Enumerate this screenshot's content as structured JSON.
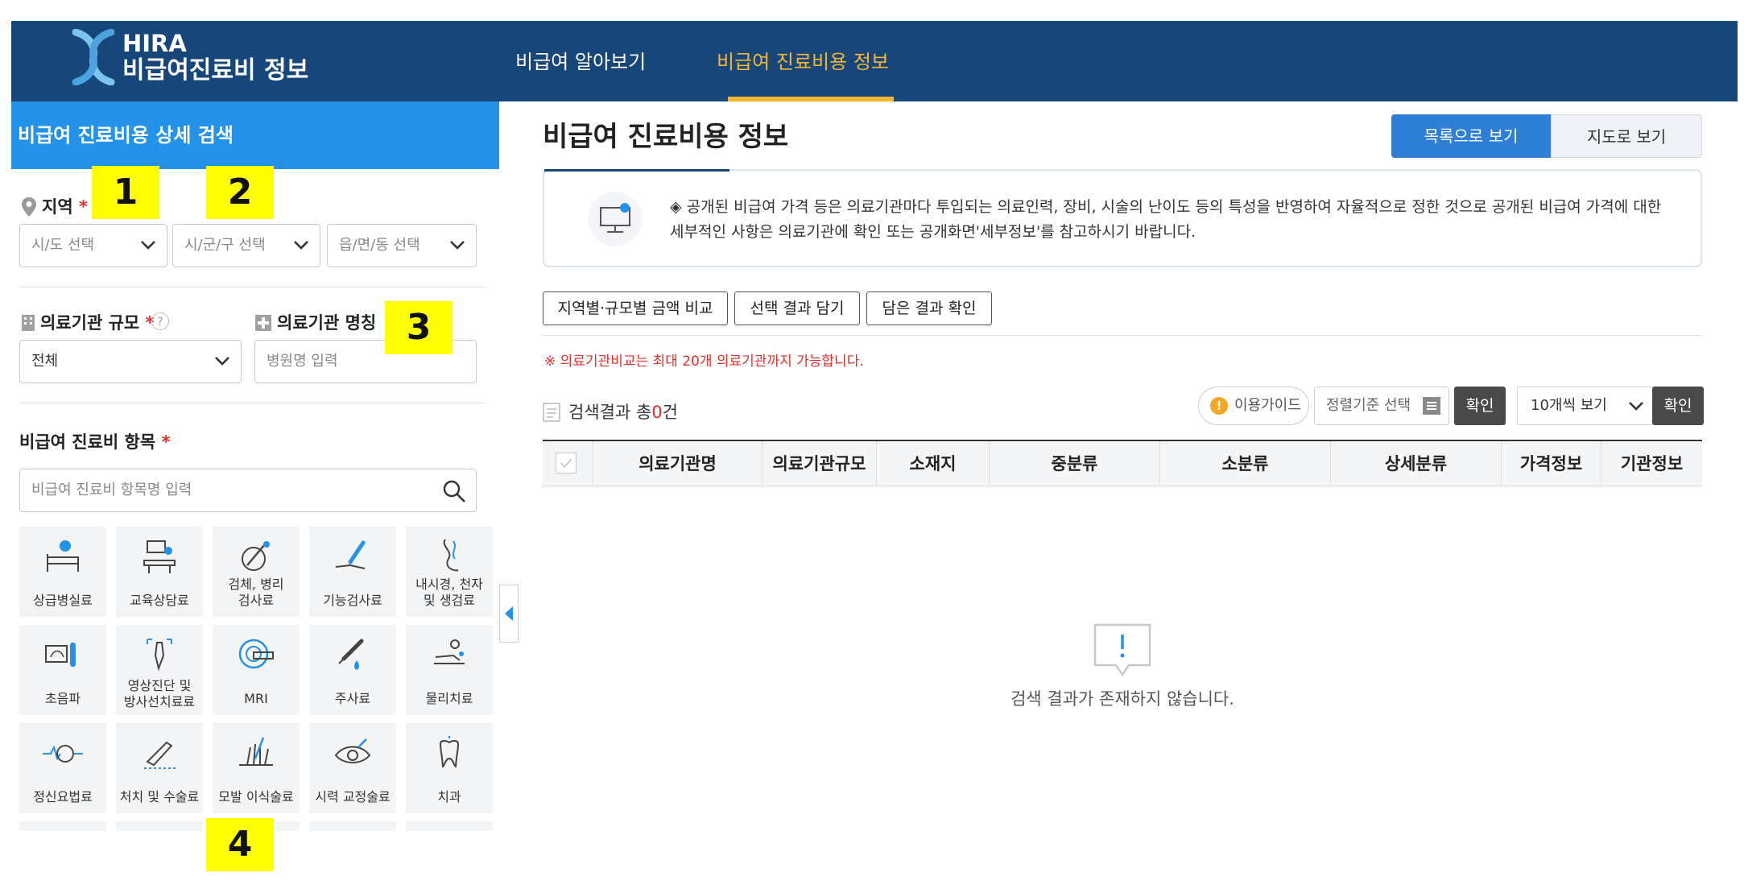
{
  "header": {
    "logo_en": "HIRA",
    "logo_kr": "비급여진료비 정보",
    "nav": [
      {
        "label": "비급여 알아보기",
        "active": false
      },
      {
        "label": "비급여 진료비용 정보",
        "active": true
      }
    ]
  },
  "sidebar": {
    "title": "비급여 진료비용 상세 검색",
    "region": {
      "label": "지역",
      "required": "*",
      "selects": [
        "시/도 선택",
        "시/군/구 선택",
        "읍/면/동 선택"
      ]
    },
    "scale": {
      "label": "의료기관 규모",
      "required": "*",
      "help": "?",
      "value": "전체"
    },
    "name": {
      "label": "의료기관 명칭",
      "placeholder": "병원명 입력"
    },
    "items": {
      "label": "비급여 진료비 항목",
      "required": "*",
      "search_placeholder": "비급여 진료비 항목명 입력",
      "categories": [
        "상급병실료",
        "교육상담료",
        "검체, 병리\n검사료",
        "기능검사료",
        "내시경, 천자\n및 생검료",
        "초음파",
        "영상진단 및\n방사선치료료",
        "MRI",
        "주사료",
        "물리치료",
        "정신요법료",
        "처치 및 수술료",
        "모발 이식술료",
        "시력 교정술료",
        "치과"
      ]
    }
  },
  "markers": [
    "1",
    "2",
    "3",
    "4"
  ],
  "main": {
    "title": "비급여 진료비용 정보",
    "view_buttons": [
      "목록으로 보기",
      "지도로 보기"
    ],
    "notice": "◈ 공개된 비급여 가격 등은 의료기관마다 투입되는 의료인력, 장비, 시술의 난이도 등의 특성을 반영하여 자율적으로 정한 것으로 공개된 비급여 가격에 대한 세부적인 사항은 의료기관에 확인 또는 공개화면'세부정보'를 참고하시기 바랍니다.",
    "option_buttons": [
      "지역별·규모별 금액 비교",
      "선택 결과 담기",
      "담은 결과 확인"
    ],
    "warning": "※ 의료기관비교는 최대 20개 의료기관까지 가능합니다.",
    "result": {
      "prefix": "검색결과 총",
      "count": "0",
      "suffix": "건"
    },
    "guide_label": "이용가이드",
    "sort_placeholder": "정렬기준 선택",
    "confirm_label": "확인",
    "page_size": "10개씩 보기",
    "columns": [
      "의료기관명",
      "의료기관규모",
      "소재지",
      "중분류",
      "소분류",
      "상세분류",
      "가격정보",
      "기관정보"
    ],
    "empty_message": "검색 결과가 존재하지 않습니다."
  },
  "colors": {
    "header_bg": "#17467a",
    "accent_yellow": "#f5b733",
    "sidebar_title_bg": "#2392e8",
    "primary_button": "#2f7fd6",
    "required_red": "#e0322d",
    "marker_yellow": "#ffff00"
  }
}
